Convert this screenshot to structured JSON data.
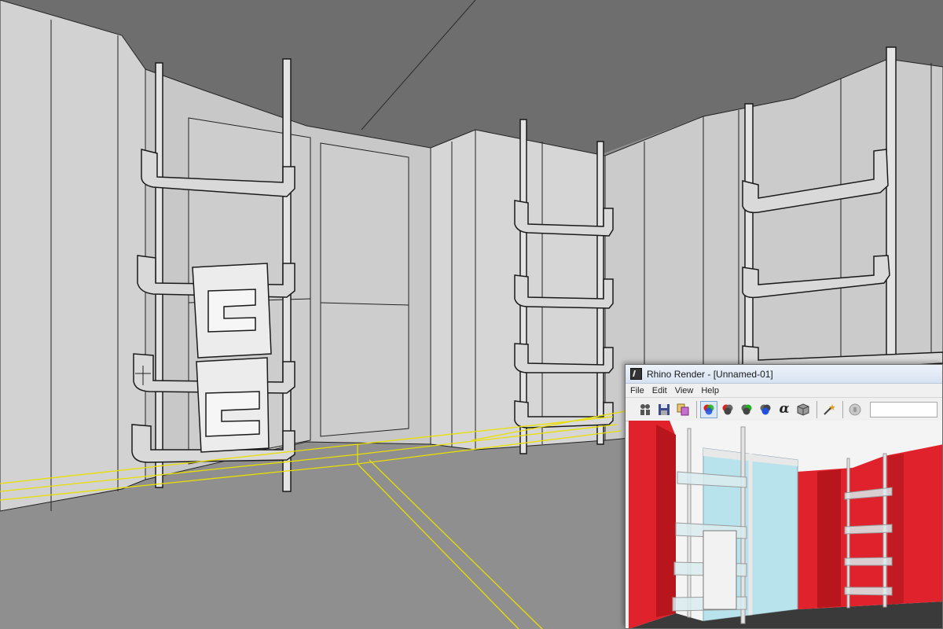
{
  "render_window": {
    "title": "Rhino Render - [Unnamed-01]",
    "menu": [
      "File",
      "Edit",
      "View",
      "Help"
    ],
    "toolbar": {
      "buttons": [
        {
          "name": "render-icon"
        },
        {
          "name": "save-icon"
        },
        {
          "name": "copy-image-icon"
        },
        {
          "name": "rgb-channels-icon",
          "active": true
        },
        {
          "name": "red-channel-icon"
        },
        {
          "name": "green-channel-icon"
        },
        {
          "name": "blue-channel-icon"
        },
        {
          "name": "alpha-channel-icon",
          "glyph": "α"
        },
        {
          "name": "3d-view-icon"
        },
        {
          "name": "post-effects-wand-icon"
        },
        {
          "name": "stop-render-icon",
          "disabled": true
        }
      ]
    },
    "colors": {
      "wall": "#e0222c",
      "glass": "#b9e3ec",
      "floor": "#3a3a3a"
    }
  },
  "viewport": {
    "colors": {
      "wall": "#cfcfcf",
      "ceiling": "#6c6c6c",
      "floor": "#8f8f8f",
      "selection": "#e8e000"
    }
  }
}
